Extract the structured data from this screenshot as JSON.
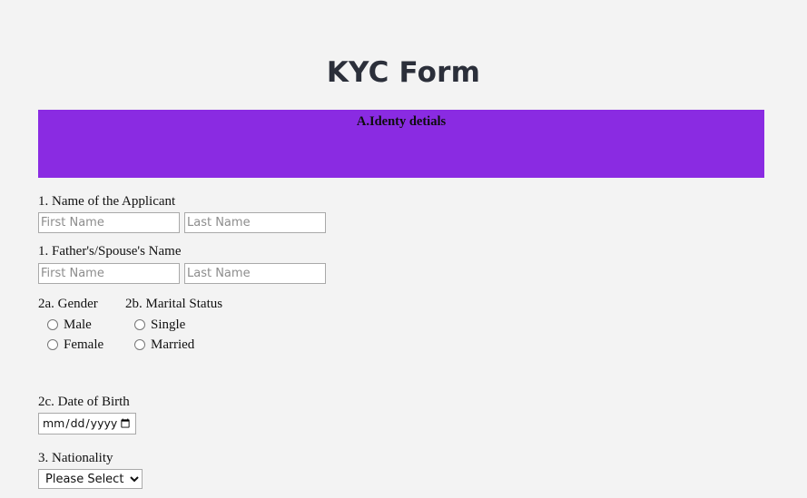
{
  "page": {
    "title": "KYC Form",
    "background_color": "#f3f3f3"
  },
  "section": {
    "banner_title": "A.Identy detials",
    "banner_color": "#8A2BE2"
  },
  "fields": {
    "applicant_name": {
      "label": "1. Name of the Applicant",
      "first_placeholder": "First Name",
      "first_value": "",
      "last_placeholder": "Last Name",
      "last_value": ""
    },
    "father_spouse_name": {
      "label": "1. Father's/Spouse's Name",
      "first_placeholder": "First Name",
      "first_value": "",
      "last_placeholder": "Last Name",
      "last_value": ""
    },
    "gender": {
      "label": "2a. Gender",
      "options": [
        {
          "label": "Male",
          "value": "male",
          "selected": false
        },
        {
          "label": "Female",
          "value": "female",
          "selected": false
        }
      ]
    },
    "marital_status": {
      "label": "2b. Marital Status",
      "options": [
        {
          "label": "Single",
          "value": "single",
          "selected": false
        },
        {
          "label": "Married",
          "value": "married",
          "selected": false
        }
      ]
    },
    "date_of_birth": {
      "label": "2c. Date of Birth",
      "placeholder": "mm/dd/yyyy",
      "value": "",
      "icon": "calendar-icon"
    },
    "nationality": {
      "label": "3. Nationality",
      "selected": "Please Select",
      "options": [
        "Please Select"
      ],
      "icon": "chevron-down-icon"
    }
  }
}
